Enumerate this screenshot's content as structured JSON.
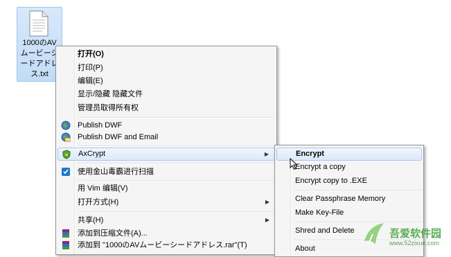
{
  "desktop_file": {
    "name_lines": [
      "1000のAV",
      "ムービーシ",
      "ードアドレ",
      "ス.txt"
    ]
  },
  "context_menu": {
    "items": [
      {
        "label": "打开(O)",
        "bold": true
      },
      {
        "label": "打印(P)"
      },
      {
        "label": "编辑(E)"
      },
      {
        "label": "显示/隐藏 隐藏文件"
      },
      {
        "label": "管理员取得所有权"
      },
      {
        "label": "Publish DWF",
        "icon": "globe-icon"
      },
      {
        "label": "Publish DWF and Email",
        "icon": "globe-mail-icon"
      },
      {
        "label": "AxCrypt",
        "icon": "axcrypt-shield-icon",
        "submenu": true,
        "highlighted": true
      },
      {
        "label": "使用金山毒霸进行扫描",
        "icon": "kingsoft-scan-icon"
      },
      {
        "label": "用 Vim 编辑(V)"
      },
      {
        "label": "打开方式(H)",
        "submenu": true
      },
      {
        "label": "共享(H)",
        "submenu": true
      },
      {
        "label": "添加到压缩文件(A)...",
        "icon": "winrar-icon"
      },
      {
        "label": "添加到 \"1000のAVムービーシードアドレス.rar\"(T)",
        "icon": "winrar-icon"
      }
    ]
  },
  "axcrypt_submenu": {
    "items": [
      {
        "label": "Encrypt",
        "bold": true,
        "highlighted": true
      },
      {
        "label": "Encrypt a copy"
      },
      {
        "label": "Encrypt copy to .EXE"
      },
      {
        "label": "Clear Passphrase Memory"
      },
      {
        "label": "Make Key-File"
      },
      {
        "label": "Shred and Delete"
      },
      {
        "label": "About"
      }
    ]
  },
  "watermark": {
    "brand": "吾爱软件园",
    "url": "www.52zixue.com"
  },
  "colors": {
    "highlight_border": "#a9c7ec",
    "selection_bg": "#cfe2f8",
    "watermark_green": "#3fa33a"
  }
}
